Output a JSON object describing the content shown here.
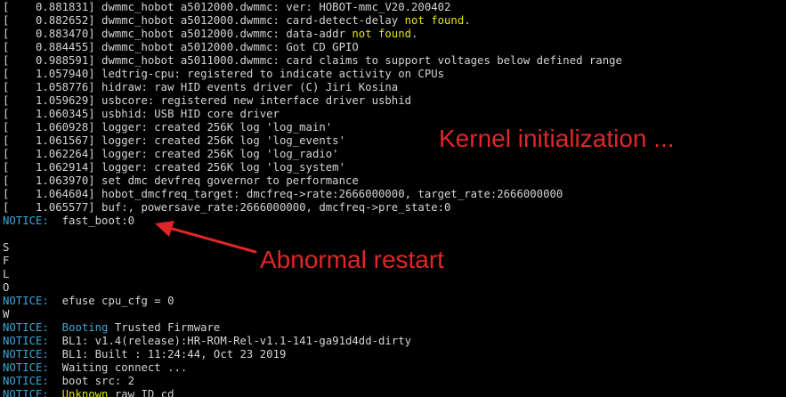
{
  "terminal": {
    "lines": [
      {
        "segments": [
          {
            "text": "[    0.881831] dwmmc_hobot a5012000.dwmmc: ver: HOBOT-mmc_V20.200402",
            "color": "default"
          }
        ]
      },
      {
        "segments": [
          {
            "text": "[    0.882652] dwmmc_hobot a5012000.dwmmc: card-detect-delay ",
            "color": "default"
          },
          {
            "text": "not found",
            "color": "yellow"
          },
          {
            "text": ".",
            "color": "default"
          }
        ]
      },
      {
        "segments": [
          {
            "text": "[    0.883470] dwmmc_hobot a5012000.dwmmc: data-addr ",
            "color": "default"
          },
          {
            "text": "not found",
            "color": "yellow"
          },
          {
            "text": ".",
            "color": "default"
          }
        ]
      },
      {
        "segments": [
          {
            "text": "[    0.884455] dwmmc_hobot a5012000.dwmmc: Got CD GPIO",
            "color": "default"
          }
        ]
      },
      {
        "segments": [
          {
            "text": "[    0.988591] dwmmc_hobot a5011000.dwmmc: card claims to support voltages below defined range",
            "color": "default"
          }
        ]
      },
      {
        "segments": [
          {
            "text": "[    1.057940] ledtrig-cpu: registered to indicate activity on CPUs",
            "color": "default"
          }
        ]
      },
      {
        "segments": [
          {
            "text": "[    1.058776] hidraw: raw HID events driver (C) Jiri Kosina",
            "color": "default"
          }
        ]
      },
      {
        "segments": [
          {
            "text": "[    1.059629] usbcore: registered new interface driver usbhid",
            "color": "default"
          }
        ]
      },
      {
        "segments": [
          {
            "text": "[    1.060345] usbhid: USB HID core driver",
            "color": "default"
          }
        ]
      },
      {
        "segments": [
          {
            "text": "[    1.060928] logger: created 256K log 'log_main'",
            "color": "default"
          }
        ]
      },
      {
        "segments": [
          {
            "text": "[    1.061567] logger: created 256K log 'log_events'",
            "color": "default"
          }
        ]
      },
      {
        "segments": [
          {
            "text": "[    1.062264] logger: created 256K log 'log_radio'",
            "color": "default"
          }
        ]
      },
      {
        "segments": [
          {
            "text": "[    1.062914] logger: created 256K log 'log_system'",
            "color": "default"
          }
        ]
      },
      {
        "segments": [
          {
            "text": "[    1.063970] set dmc devfreq governor to performance",
            "color": "default"
          }
        ]
      },
      {
        "segments": [
          {
            "text": "[    1.064604] hobot_dmcfreq_target: dmcfreq->rate:2666000000, target_rate:2666000000",
            "color": "default"
          }
        ]
      },
      {
        "segments": [
          {
            "text": "[    1.065577] buf:, powersave_rate:2666000000, dmcfreq->pre_state:0",
            "color": "default"
          }
        ]
      },
      {
        "segments": [
          {
            "text": "NOTICE:",
            "color": "notice"
          },
          {
            "text": "  fast_boot:0",
            "color": "default"
          }
        ]
      },
      {
        "segments": [
          {
            "text": "",
            "color": "default"
          }
        ]
      },
      {
        "segments": [
          {
            "text": "S",
            "color": "default"
          }
        ]
      },
      {
        "segments": [
          {
            "text": "F",
            "color": "default"
          }
        ]
      },
      {
        "segments": [
          {
            "text": "L",
            "color": "default"
          }
        ]
      },
      {
        "segments": [
          {
            "text": "O",
            "color": "default"
          }
        ]
      },
      {
        "segments": [
          {
            "text": "NOTICE:",
            "color": "notice"
          },
          {
            "text": "  efuse cpu_cfg = 0",
            "color": "default"
          }
        ]
      },
      {
        "segments": [
          {
            "text": "W",
            "color": "default"
          }
        ]
      },
      {
        "segments": [
          {
            "text": "NOTICE:",
            "color": "notice"
          },
          {
            "text": "  ",
            "color": "default"
          },
          {
            "text": "Booting",
            "color": "notice"
          },
          {
            "text": " Trusted Firmware",
            "color": "default"
          }
        ]
      },
      {
        "segments": [
          {
            "text": "NOTICE:",
            "color": "notice"
          },
          {
            "text": "  BL1: v1.4(release):HR-ROM-Rel-v1.1-141-ga91d4dd-dirty",
            "color": "default"
          }
        ]
      },
      {
        "segments": [
          {
            "text": "NOTICE:",
            "color": "notice"
          },
          {
            "text": "  BL1: Built : 11:24:44, Oct 23 2019",
            "color": "default"
          }
        ]
      },
      {
        "segments": [
          {
            "text": "NOTICE:",
            "color": "notice"
          },
          {
            "text": "  Waiting connect ...",
            "color": "default"
          }
        ]
      },
      {
        "segments": [
          {
            "text": "NOTICE:",
            "color": "notice"
          },
          {
            "text": "  boot src: 2",
            "color": "default"
          }
        ]
      },
      {
        "segments": [
          {
            "text": "NOTICE:",
            "color": "notice"
          },
          {
            "text": "  ",
            "color": "default"
          },
          {
            "text": "Unknown",
            "color": "yellow"
          },
          {
            "text": " raw ID cd",
            "color": "default"
          }
        ]
      }
    ]
  },
  "annotations": {
    "kernel": "Kernel initialization ...",
    "restart": "Abnormal restart"
  },
  "colors": {
    "background": "#000000",
    "default": "#d4d4d4",
    "notice": "#3fa7d6",
    "yellow": "#e5e510",
    "annotation": "#e0262a"
  }
}
